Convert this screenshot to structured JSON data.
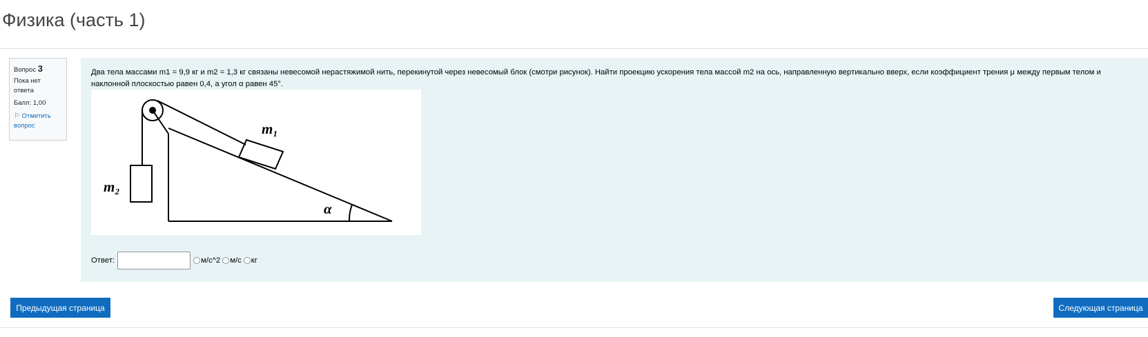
{
  "page": {
    "title": "Физика (часть 1)"
  },
  "question_info": {
    "number_label": "Вопрос",
    "number": "3",
    "state": "Пока нет ответа",
    "grade": "Балл: 1,00",
    "flag_label": "Отметить вопрос",
    "flag_icon": "flag-icon"
  },
  "question": {
    "text": "Два тела массами m1 = 9,9 кг и m2 = 1,3 кг связаны невесомой нерастяжимой нить, перекинутой через невесомый блок (смотри рисунок). Найти проекцию ускорения тела массой m2 на ось, направленную вертикально вверх, если коэффициент трения μ между первым телом и наклонной плоскостью равен 0,4, а угол α равен 45°.",
    "figure_labels": {
      "m1": "m₁",
      "m2": "m₂",
      "alpha": "α"
    }
  },
  "answer": {
    "label": "Ответ:",
    "value": "",
    "units": [
      "м/с^2",
      "м/с",
      "кг"
    ],
    "selected_unit": null
  },
  "navigation": {
    "prev_label": "Предыдущая страница",
    "next_label": "Следующая страница"
  },
  "colors": {
    "primary": "#0f6cbf",
    "formulation_bg": "#e7f3f5",
    "info_bg": "#f8f9fa"
  }
}
